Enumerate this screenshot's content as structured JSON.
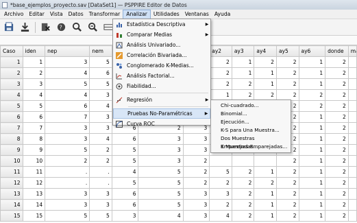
{
  "window": {
    "title": "*base_ejemplos_proyecto.sav [DataSet1] — PSPPIRE Editor de Datos"
  },
  "menubar": [
    "Archivo",
    "Editar",
    "Vista",
    "Datos",
    "Transformar",
    "Analizar",
    "Utilidades",
    "Ventanas",
    "Ayuda"
  ],
  "toolbar": {
    "buttons": [
      "open-icon",
      "save-icon",
      "variables-icon",
      "goto-case-icon",
      "find-icon",
      "zoom-icon",
      "insert-case-icon",
      "insert-variable-icon"
    ]
  },
  "grid": {
    "columns": [
      "Caso",
      "iden",
      "nep",
      "nem",
      "prensa",
      "",
      "",
      "ay2",
      "ay3",
      "ay4",
      "ay5",
      "ay6",
      "donde",
      "ma"
    ],
    "rows": [
      [
        "1",
        "1",
        "3",
        "5",
        "",
        "",
        "",
        "2",
        "1",
        "2",
        "2",
        "1",
        "2",
        ""
      ],
      [
        "2",
        "2",
        "4",
        "6",
        "",
        "",
        "",
        "2",
        "1",
        "1",
        "2",
        "1",
        "2",
        ""
      ],
      [
        "3",
        "3",
        "5",
        "5",
        "",
        "",
        "",
        "2",
        "2",
        "1",
        "2",
        "1",
        "2",
        ""
      ],
      [
        "4",
        "4",
        "4",
        "3",
        "",
        "",
        "",
        "1",
        "2",
        "2",
        "2",
        "2",
        "2",
        ""
      ],
      [
        "5",
        "5",
        "6",
        "4",
        "",
        "",
        "",
        "2",
        "1",
        "1",
        "2",
        "2",
        "2",
        ""
      ],
      [
        "6",
        "6",
        "7",
        "3",
        "",
        "",
        "",
        "",
        "",
        "",
        "2",
        "1",
        "2",
        ""
      ],
      [
        "7",
        "7",
        "3",
        "3",
        "6",
        "2",
        "3",
        "",
        "",
        "",
        "2",
        "1",
        "2",
        ""
      ],
      [
        "8",
        "8",
        "3",
        "4",
        "6",
        "3",
        "3",
        "",
        "",
        "",
        "2",
        "1",
        "2",
        ""
      ],
      [
        "9",
        "9",
        "5",
        "2",
        "5",
        "3",
        "3",
        "",
        "",
        "",
        "2",
        "1",
        "2",
        ""
      ],
      [
        "10",
        "10",
        "2",
        "2",
        "5",
        "3",
        "2",
        "",
        "",
        "",
        "2",
        "1",
        "2",
        ""
      ],
      [
        "11",
        "11",
        ".",
        ".",
        "4",
        "5",
        "2",
        "5",
        "2",
        "1",
        "2",
        "1",
        "2",
        ""
      ],
      [
        "12",
        "12",
        ".",
        ".",
        "5",
        "5",
        "2",
        "2",
        "2",
        "2",
        "2",
        "1",
        "2",
        ""
      ],
      [
        "13",
        "13",
        "3",
        "3",
        "6",
        "5",
        "3",
        "3",
        "2",
        "1",
        "2",
        "1",
        "2",
        ""
      ],
      [
        "14",
        "14",
        "3",
        "3",
        "6",
        "5",
        "3",
        "2",
        "2",
        "1",
        "2",
        "1",
        "2",
        ""
      ],
      [
        "15",
        "15",
        "5",
        "5",
        "3",
        "4",
        "3",
        "4",
        "2",
        "1",
        "2",
        "1",
        "2",
        ""
      ]
    ]
  },
  "analizar_menu": {
    "items": [
      {
        "label": "Estadística Descriptiva",
        "icon": "descriptive-stats-icon",
        "submenu": true
      },
      {
        "label": "Comparar Medias",
        "icon": "compare-means-icon",
        "submenu": true
      },
      {
        "label": "Análisis Univariado...",
        "icon": "univariate-icon",
        "submenu": false
      },
      {
        "label": "Correlación Bivariada...",
        "icon": "correlation-icon",
        "submenu": false
      },
      {
        "label": "Conglomerado K-Medias...",
        "icon": "kmeans-icon",
        "submenu": false
      },
      {
        "label": "Análisis Factorial...",
        "icon": "factor-icon",
        "submenu": false
      },
      {
        "label": "Fiabilidad...",
        "icon": "reliability-icon",
        "submenu": false
      },
      {
        "label": "Regresión",
        "icon": "regression-icon",
        "submenu": true
      },
      {
        "label": "Pruebas No-Paramétricas",
        "icon": "nonparametric-icon",
        "submenu": true
      },
      {
        "label": "Curva ROC",
        "icon": "roc-curve-icon",
        "submenu": false
      }
    ]
  },
  "nonparametric_submenu": {
    "items": [
      "Chi-cuadrado...",
      "Binomial...",
      "Ejecución...",
      "K-S para Una Muestra...",
      "Dos Muestras Emparejadas...",
      "K Muestras Emparejadas..."
    ]
  }
}
